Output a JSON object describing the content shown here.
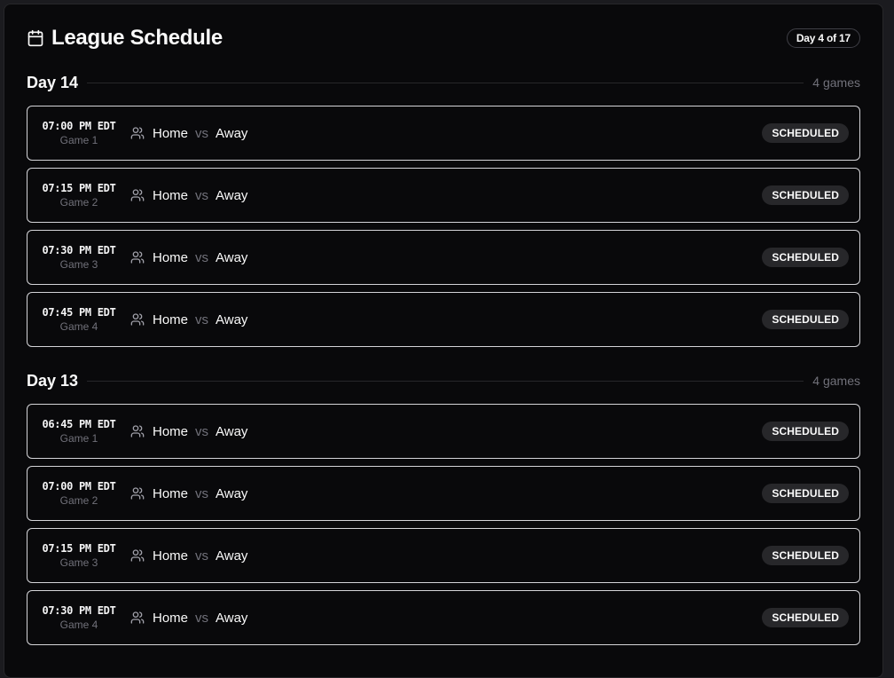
{
  "header": {
    "title": "League Schedule",
    "badge": "Day 4 of 17",
    "icon": "calendar-icon"
  },
  "days": [
    {
      "label": "Day 14",
      "count": "4 games",
      "games": [
        {
          "time": "07:00 PM EDT",
          "game": "Game 1",
          "home": "Home",
          "vs": "vs",
          "away": "Away",
          "status": "SCHEDULED"
        },
        {
          "time": "07:15 PM EDT",
          "game": "Game 2",
          "home": "Home",
          "vs": "vs",
          "away": "Away",
          "status": "SCHEDULED"
        },
        {
          "time": "07:30 PM EDT",
          "game": "Game 3",
          "home": "Home",
          "vs": "vs",
          "away": "Away",
          "status": "SCHEDULED"
        },
        {
          "time": "07:45 PM EDT",
          "game": "Game 4",
          "home": "Home",
          "vs": "vs",
          "away": "Away",
          "status": "SCHEDULED"
        }
      ]
    },
    {
      "label": "Day 13",
      "count": "4 games",
      "games": [
        {
          "time": "06:45 PM EDT",
          "game": "Game 1",
          "home": "Home",
          "vs": "vs",
          "away": "Away",
          "status": "SCHEDULED"
        },
        {
          "time": "07:00 PM EDT",
          "game": "Game 2",
          "home": "Home",
          "vs": "vs",
          "away": "Away",
          "status": "SCHEDULED"
        },
        {
          "time": "07:15 PM EDT",
          "game": "Game 3",
          "home": "Home",
          "vs": "vs",
          "away": "Away",
          "status": "SCHEDULED"
        },
        {
          "time": "07:30 PM EDT",
          "game": "Game 4",
          "home": "Home",
          "vs": "vs",
          "away": "Away",
          "status": "SCHEDULED"
        }
      ]
    }
  ],
  "colors": {
    "background": "#09090b",
    "border": "#d4d4d8",
    "muted": "#71717a",
    "badge_bg": "#27272a"
  }
}
